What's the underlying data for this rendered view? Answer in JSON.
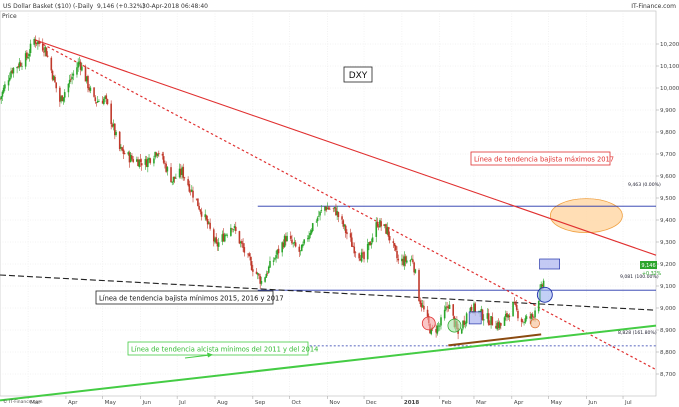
{
  "header": {
    "instrument": "US Dollar Basket ($10) (-)",
    "interval": "Daily",
    "last": "9,146 (+0.32%)",
    "datetime": "30-Apr-2018 06:48:40",
    "source": "IT-Finance.com",
    "price_tag": "Price",
    "footer_source": "© IT-Finance.com"
  },
  "colors": {
    "up": "#2aa52a",
    "down": "#c0392b",
    "red_line": "#e03030",
    "blue_line": "#2233aa",
    "green_line": "#44cc44",
    "black_dash": "#222222",
    "brown_line": "#8a4a10",
    "orange_fill": "#ffd8a8",
    "orange_stroke": "#f0a040"
  },
  "chart_data": {
    "type": "candlestick",
    "title": "DXY",
    "ylim": [
      8.6,
      10.35
    ],
    "yticks": [
      "10,200",
      "10,100",
      "10,000",
      "9,900",
      "9,800",
      "9,700",
      "9,600",
      "9,500",
      "9,400",
      "9,300",
      "9,200",
      "9,100",
      "9,000",
      "8,900",
      "8,800",
      "8,700"
    ],
    "ytick_values": [
      10.2,
      10.1,
      10.0,
      9.9,
      9.8,
      9.7,
      9.6,
      9.5,
      9.4,
      9.3,
      9.2,
      9.1,
      9.0,
      8.9,
      8.8,
      8.7
    ],
    "xticks": [
      "Mar",
      "Apr",
      "May",
      "Jun",
      "Jul",
      "Aug",
      "Sep",
      "Oct",
      "Nov",
      "Dec",
      "2018",
      "Feb",
      "Mar",
      "Apr",
      "May",
      "Jun",
      "Jul"
    ],
    "xtick_dates": [
      "2017-03-01",
      "2017-04-01",
      "2017-05-01",
      "2017-06-01",
      "2017-07-01",
      "2017-08-01",
      "2017-09-01",
      "2017-10-01",
      "2017-11-01",
      "2017-12-01",
      "2018-01-01",
      "2018-02-01",
      "2018-03-01",
      "2018-04-01",
      "2018-05-01",
      "2018-06-01",
      "2018-07-01"
    ],
    "x_start": "2017-02-06",
    "x_end": "2018-07-28",
    "price_path": [
      [
        "2017-02-06",
        9.95
      ],
      [
        "2017-02-15",
        10.08
      ],
      [
        "2017-02-28",
        10.14
      ],
      [
        "2017-03-06",
        10.22
      ],
      [
        "2017-03-15",
        10.18
      ],
      [
        "2017-03-27",
        9.94
      ],
      [
        "2017-04-05",
        10.04
      ],
      [
        "2017-04-12",
        10.12
      ],
      [
        "2017-04-24",
        9.94
      ],
      [
        "2017-05-03",
        9.95
      ],
      [
        "2017-05-15",
        9.72
      ],
      [
        "2017-05-24",
        9.68
      ],
      [
        "2017-06-05",
        9.66
      ],
      [
        "2017-06-15",
        9.72
      ],
      [
        "2017-06-27",
        9.58
      ],
      [
        "2017-07-05",
        9.62
      ],
      [
        "2017-07-14",
        9.52
      ],
      [
        "2017-07-26",
        9.38
      ],
      [
        "2017-08-02",
        9.28
      ],
      [
        "2017-08-15",
        9.38
      ],
      [
        "2017-08-28",
        9.22
      ],
      [
        "2017-09-08",
        9.12
      ],
      [
        "2017-09-18",
        9.22
      ],
      [
        "2017-09-28",
        9.32
      ],
      [
        "2017-10-10",
        9.25
      ],
      [
        "2017-10-20",
        9.38
      ],
      [
        "2017-10-30",
        9.46
      ],
      [
        "2017-11-08",
        9.44
      ],
      [
        "2017-11-22",
        9.28
      ],
      [
        "2017-12-01",
        9.22
      ],
      [
        "2017-12-12",
        9.39
      ],
      [
        "2017-12-20",
        9.35
      ],
      [
        "2017-12-29",
        9.21
      ],
      [
        "2018-01-10",
        9.22
      ],
      [
        "2018-01-15",
        9.05
      ],
      [
        "2018-01-25",
        8.89
      ],
      [
        "2018-02-01",
        8.92
      ],
      [
        "2018-02-08",
        9.02
      ],
      [
        "2018-02-16",
        8.88
      ],
      [
        "2018-02-26",
        9.01
      ],
      [
        "2018-03-05",
        8.98
      ],
      [
        "2018-03-15",
        8.94
      ],
      [
        "2018-03-23",
        8.92
      ],
      [
        "2018-04-02",
        9.01
      ],
      [
        "2018-04-10",
        8.94
      ],
      [
        "2018-04-18",
        8.96
      ],
      [
        "2018-04-23",
        9.05
      ],
      [
        "2018-04-27",
        9.12
      ],
      [
        "2018-04-30",
        9.146
      ]
    ],
    "annotations": {
      "downtrend_2017_label": "Línea de tendencia bajista máximos 2017",
      "downtrend_2015_label": "Línea de tendencia bajista mínimos 2015, 2016 y 2017",
      "uptrend_label": "Línea de tendencia alcista mínimos del 2011 y del 2014",
      "fib_0_label": "9,463 (0.00%)",
      "fib_100_label": "9,081 (100.00%)",
      "fib_161_label": "8,828 (161.80%)",
      "last_price": "9,146",
      "last_change": "+0.32%"
    },
    "levels": {
      "fib_0": 9.463,
      "fib_100": 9.081,
      "fib_161": 8.828
    },
    "lines": {
      "red_2017": [
        [
          "2017-03-06",
          10.22
        ],
        [
          "2018-07-28",
          9.24
        ]
      ],
      "red_dotted": [
        [
          "2017-03-06",
          10.22
        ],
        [
          "2018-07-28",
          8.72
        ]
      ],
      "black_dash": [
        [
          "2017-02-06",
          9.15
        ],
        [
          "2018-07-28",
          8.99
        ]
      ],
      "green_up": [
        [
          "2017-02-06",
          8.58
        ],
        [
          "2018-07-28",
          8.92
        ]
      ],
      "brown": [
        [
          "2018-02-08",
          8.83
        ],
        [
          "2018-04-25",
          8.88
        ]
      ]
    }
  }
}
